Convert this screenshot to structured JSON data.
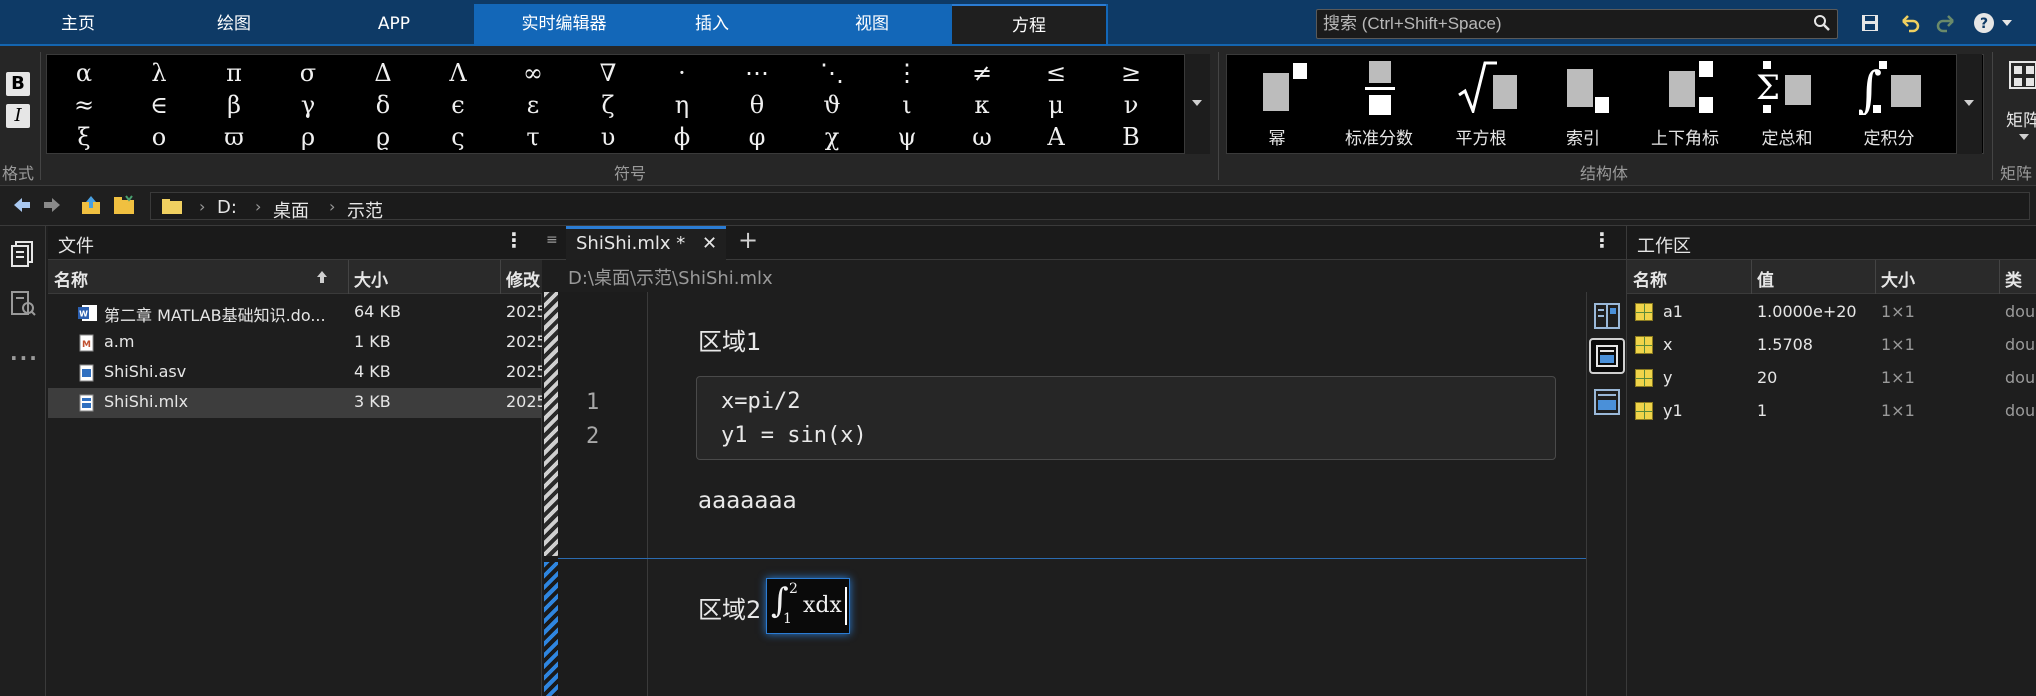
{
  "top_tabs": [
    "主页",
    "绘图",
    "APP",
    "实时编辑器",
    "插入",
    "视图",
    "方程"
  ],
  "active_tab": "方程",
  "search_placeholder": "搜索 (Ctrl+Shift+Space)",
  "ribbon": {
    "format_label": "格式",
    "format_buttons": [
      "B",
      "I"
    ],
    "symbols_label": "符号",
    "symbols": [
      [
        "α",
        "λ",
        "π",
        "σ",
        "Δ",
        "Λ",
        "∞",
        "∇",
        "·",
        "⋯",
        "⋱",
        "⋮",
        "≠",
        "≤",
        "≥"
      ],
      [
        "≈",
        "∈",
        "β",
        "γ",
        "δ",
        "ϵ",
        "ε",
        "ζ",
        "η",
        "θ",
        "ϑ",
        "ι",
        "κ",
        "μ",
        "ν"
      ],
      [
        "ξ",
        "ο",
        "ϖ",
        "ρ",
        "ϱ",
        "ς",
        "τ",
        "υ",
        "ϕ",
        "φ",
        "χ",
        "ψ",
        "ω",
        "Α",
        "Β"
      ]
    ],
    "structures_label": "结构体",
    "structures": [
      "幂",
      "标准分数",
      "平方根",
      "索引",
      "上下角标",
      "定总和",
      "定积分"
    ],
    "matrix_label": "矩阵",
    "matrix_group_label": "矩阵"
  },
  "address": {
    "crumbs": [
      "D:",
      "桌面",
      "示范"
    ]
  },
  "files": {
    "title": "文件",
    "columns": [
      "名称",
      "大小",
      "修改"
    ],
    "rows": [
      {
        "name": "第二章 MATLAB基础知识.do...",
        "size": "64 KB",
        "modified": "2025",
        "icon": "word-doc-icon"
      },
      {
        "name": "a.m",
        "size": "1 KB",
        "modified": "2025",
        "icon": "m-file-icon"
      },
      {
        "name": "ShiShi.asv",
        "size": "4 KB",
        "modified": "2025",
        "icon": "asv-file-icon"
      },
      {
        "name": "ShiShi.mlx",
        "size": "3 KB",
        "modified": "2025",
        "icon": "mlx-file-icon"
      }
    ],
    "selected_row": "ShiShi.mlx"
  },
  "editor": {
    "tab_label": "ShiShi.mlx *",
    "path": "D:\\桌面\\示范\\ShiShi.mlx",
    "section1_title": "区域1",
    "line_numbers": [
      "1",
      "2"
    ],
    "code_lines": [
      "x=pi/2",
      "y1 = sin(x)"
    ],
    "text_line": "aaaaaaa",
    "section2_title": "区域2",
    "equation": {
      "symbol": "∫",
      "lower": "1",
      "upper": "2",
      "body": "xdx"
    }
  },
  "workspace": {
    "title": "工作区",
    "columns": [
      "名称",
      "值",
      "大小",
      "类"
    ],
    "rows": [
      {
        "name": "a1",
        "value": "1.0000e+20",
        "size": "1×1",
        "class": "dou"
      },
      {
        "name": "x",
        "value": "1.5708",
        "size": "1×1",
        "class": "dou"
      },
      {
        "name": "y",
        "value": "20",
        "size": "1×1",
        "class": "dou"
      },
      {
        "name": "y1",
        "value": "1",
        "size": "1×1",
        "class": "dou"
      }
    ]
  },
  "colors": {
    "accent": "#2b7cd3",
    "topbar": "#0e3a66",
    "contextual_tabs": "#1367b8"
  }
}
